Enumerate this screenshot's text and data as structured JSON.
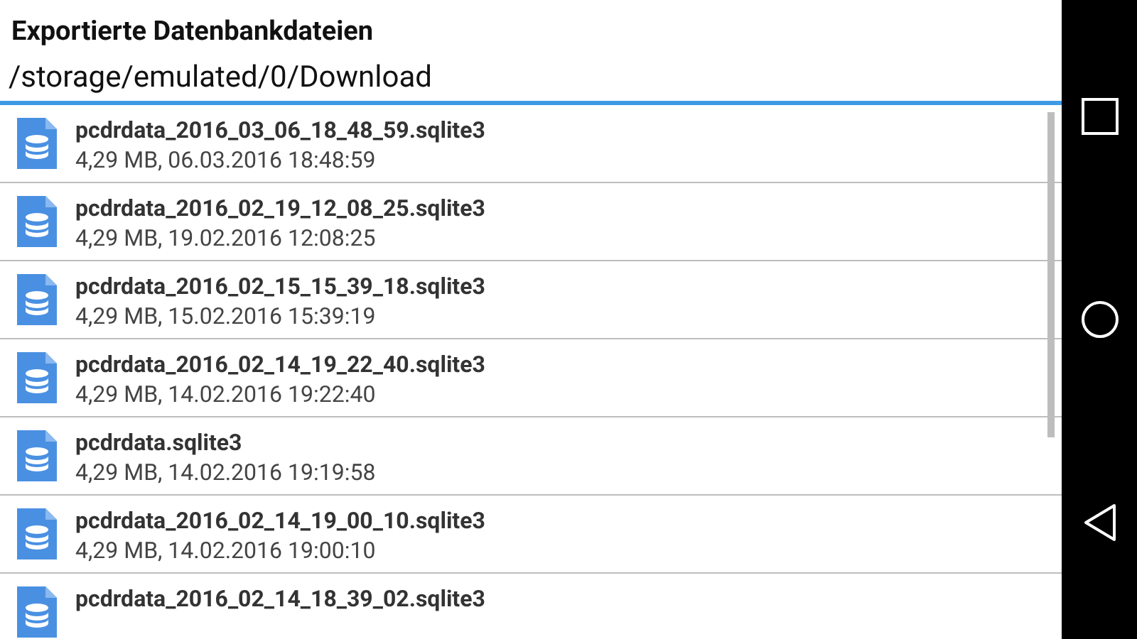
{
  "title": "Exportierte Datenbankdateien",
  "path": {
    "value": "/storage/emulated/0/Download"
  },
  "files": [
    {
      "name": "pcdrdata_2016_03_06_18_48_59.sqlite3",
      "meta": "4,29 MB, 06.03.2016 18:48:59"
    },
    {
      "name": "pcdrdata_2016_02_19_12_08_25.sqlite3",
      "meta": "4,29 MB, 19.02.2016 12:08:25"
    },
    {
      "name": "pcdrdata_2016_02_15_15_39_18.sqlite3",
      "meta": "4,29 MB, 15.02.2016 15:39:19"
    },
    {
      "name": "pcdrdata_2016_02_14_19_22_40.sqlite3",
      "meta": "4,29 MB, 14.02.2016 19:22:40"
    },
    {
      "name": "pcdrdata.sqlite3",
      "meta": "4,29 MB, 14.02.2016 19:19:58"
    },
    {
      "name": "pcdrdata_2016_02_14_19_00_10.sqlite3",
      "meta": "4,29 MB, 14.02.2016 19:00:10"
    },
    {
      "name": "pcdrdata_2016_02_14_18_39_02.sqlite3"
    }
  ]
}
